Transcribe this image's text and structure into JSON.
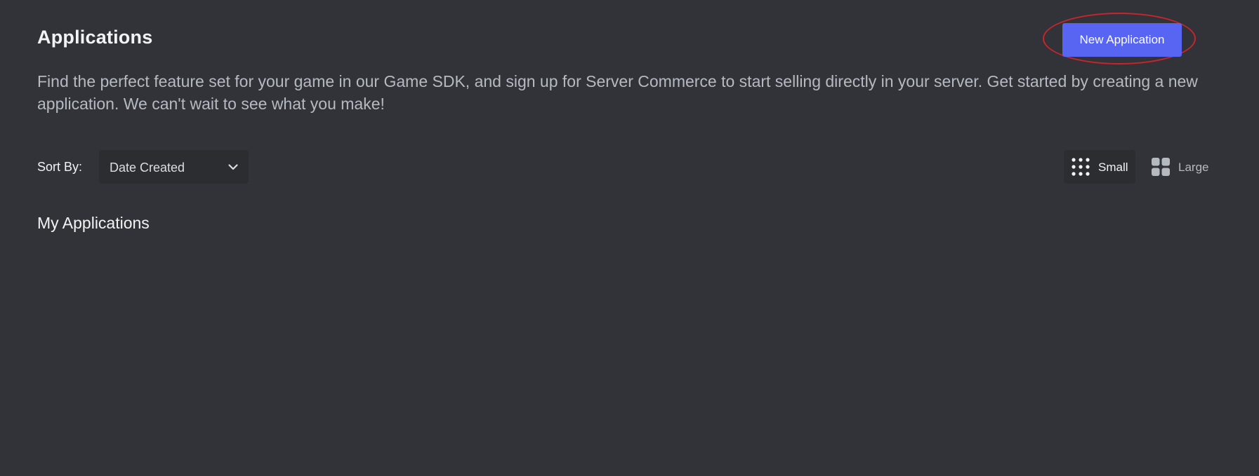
{
  "header": {
    "title": "Applications",
    "new_app_label": "New Application"
  },
  "description": "Find the perfect feature set for your game in our Game SDK, and sign up for Server Commerce to start selling directly in your server. Get started by creating a new application. We can't wait to see what you make!",
  "sort": {
    "label": "Sort By:",
    "selected": "Date Created"
  },
  "view_toggle": {
    "small_label": "Small",
    "large_label": "Large",
    "active": "Small"
  },
  "section": {
    "title": "My Applications"
  },
  "colors": {
    "background": "#313338",
    "accent": "#5865f2",
    "highlight_ring": "#c8252d"
  }
}
